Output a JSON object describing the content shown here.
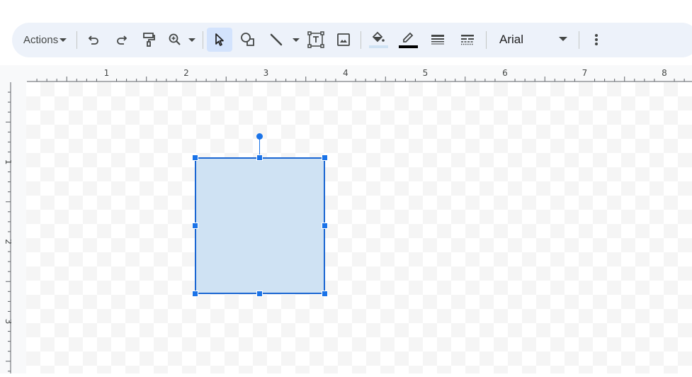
{
  "toolbar": {
    "actions_label": "Actions",
    "buttons": [
      {
        "name": "undo",
        "icon": "undo-icon"
      },
      {
        "name": "redo",
        "icon": "redo-icon"
      },
      {
        "name": "paint-format",
        "icon": "paint-roller-icon"
      },
      {
        "name": "zoom",
        "icon": "zoom-in-icon",
        "has_dropdown": true
      },
      {
        "name": "select",
        "icon": "cursor-arrow-icon",
        "active": true
      },
      {
        "name": "shape",
        "icon": "shape-icon"
      },
      {
        "name": "line",
        "icon": "line-icon",
        "has_dropdown": true
      },
      {
        "name": "text-box",
        "icon": "text-box-icon"
      },
      {
        "name": "image",
        "icon": "image-icon"
      },
      {
        "name": "fill-color",
        "icon": "paint-bucket-icon",
        "color": "#cfe2f3"
      },
      {
        "name": "border-color",
        "icon": "pencil-icon",
        "color": "#000000"
      },
      {
        "name": "border-weight",
        "icon": "border-weight-icon"
      },
      {
        "name": "border-dash",
        "icon": "border-dash-icon"
      }
    ],
    "font": "Arial",
    "more_icon": "more-vert-icon"
  },
  "ruler": {
    "horizontal_labels": [
      "1",
      "2",
      "3",
      "4",
      "5",
      "6",
      "7",
      "8"
    ],
    "vertical_labels": [
      "1",
      "2",
      "3"
    ]
  },
  "shape": {
    "type": "rectangle",
    "fill": "#cfe2f3",
    "border": "#1a66d2",
    "selected": true
  },
  "colors": {
    "accent": "#1a73e8",
    "toolbar_bg": "#edf2fa",
    "active_button_bg": "#d3e3fd"
  }
}
